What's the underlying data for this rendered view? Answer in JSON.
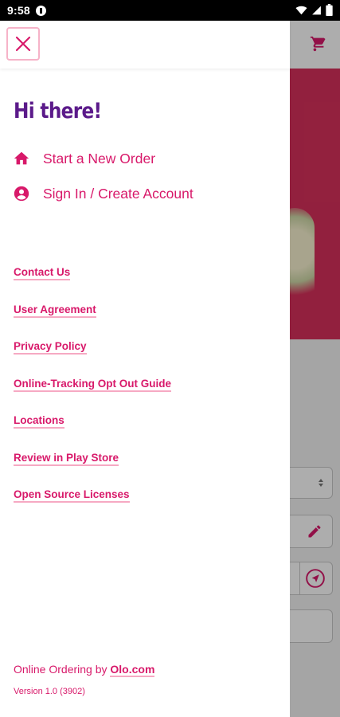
{
  "status_bar": {
    "time": "9:58"
  },
  "drawer": {
    "greeting": "Hi there!",
    "nav": [
      {
        "label": "Start a New Order",
        "icon": "home-icon"
      },
      {
        "label": "Sign In / Create Account",
        "icon": "account-circle-icon"
      }
    ],
    "links": [
      "Contact Us",
      "User Agreement",
      "Privacy Policy",
      "Online-Tracking Opt Out Guide",
      "Locations",
      "Review in Play Store",
      "Open Source Licenses"
    ],
    "footer": {
      "prefix": "Online Ordering by ",
      "link": "Olo.com"
    },
    "version": "Version 1.0 (3902)"
  },
  "colors": {
    "accent": "#d8196a",
    "greeting": "#5b1a8a",
    "hero": "#d8305c",
    "close_border": "#f6b3c8"
  }
}
